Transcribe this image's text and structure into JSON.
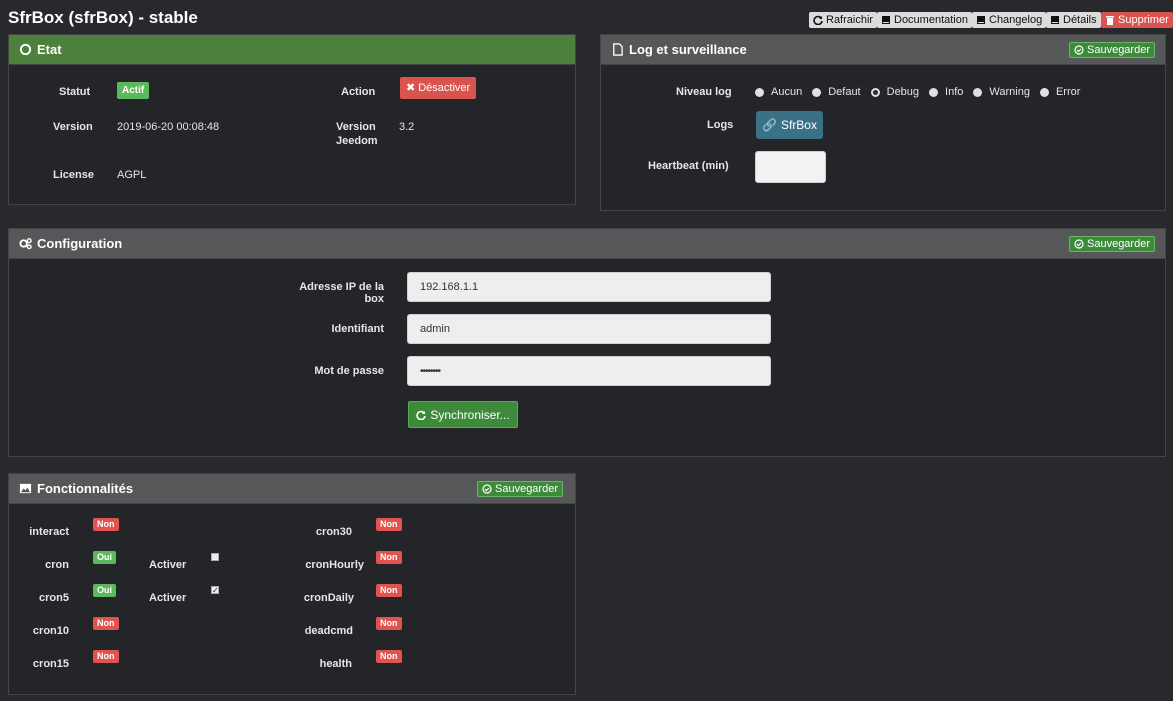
{
  "page": {
    "title": "SfrBox (sfrBox) - stable"
  },
  "toolbar": {
    "refresh": "Rafraichir",
    "documentation": "Documentation",
    "changelog": "Changelog",
    "details": "Détails",
    "delete": "Supprimer"
  },
  "etat": {
    "title": "Etat",
    "statut_label": "Statut",
    "statut_value": "Actif",
    "action_label": "Action",
    "action_button": "Désactiver",
    "version_label": "Version",
    "version_value": "2019-06-20 00:08:48",
    "version_jeedom_label_1": "Version",
    "version_jeedom_label_2": "Jeedom",
    "version_jeedom_value": "3.2",
    "license_label": "License",
    "license_value": "AGPL"
  },
  "log": {
    "title": "Log et surveillance",
    "save": "Sauvegarder",
    "niveau_label": "Niveau log",
    "levels": [
      "Aucun",
      "Defaut",
      "Debug",
      "Info",
      "Warning",
      "Error"
    ],
    "selected_level": "Debug",
    "logs_label": "Logs",
    "logs_button": "SfrBox",
    "heartbeat_label": "Heartbeat (min)",
    "heartbeat_value": ""
  },
  "config": {
    "title": "Configuration",
    "save": "Sauvegarder",
    "ip_label": "Adresse IP de la box",
    "ip_value": "192.168.1.1",
    "id_label": "Identifiant",
    "id_value": "admin",
    "pwd_label": "Mot de passe",
    "pwd_value": "••••••••",
    "sync_button": "Synchroniser..."
  },
  "func": {
    "title": "Fonctionnalités",
    "save": "Sauvegarder",
    "activer_label": "Activer",
    "left": [
      {
        "name": "interact",
        "status": "Non"
      },
      {
        "name": "cron",
        "status": "Oui"
      },
      {
        "name": "cron5",
        "status": "Oui"
      },
      {
        "name": "cron10",
        "status": "Non"
      },
      {
        "name": "cron15",
        "status": "Non"
      }
    ],
    "right": [
      {
        "name": "cron30",
        "status": "Non"
      },
      {
        "name": "cronHourly",
        "status": "Non"
      },
      {
        "name": "cronDaily",
        "status": "Non"
      },
      {
        "name": "deadcmd",
        "status": "Non"
      },
      {
        "name": "health",
        "status": "Non"
      }
    ]
  },
  "colors": {
    "green": "#4d7f3d",
    "red": "#d9534f",
    "teal": "#3a7186"
  }
}
